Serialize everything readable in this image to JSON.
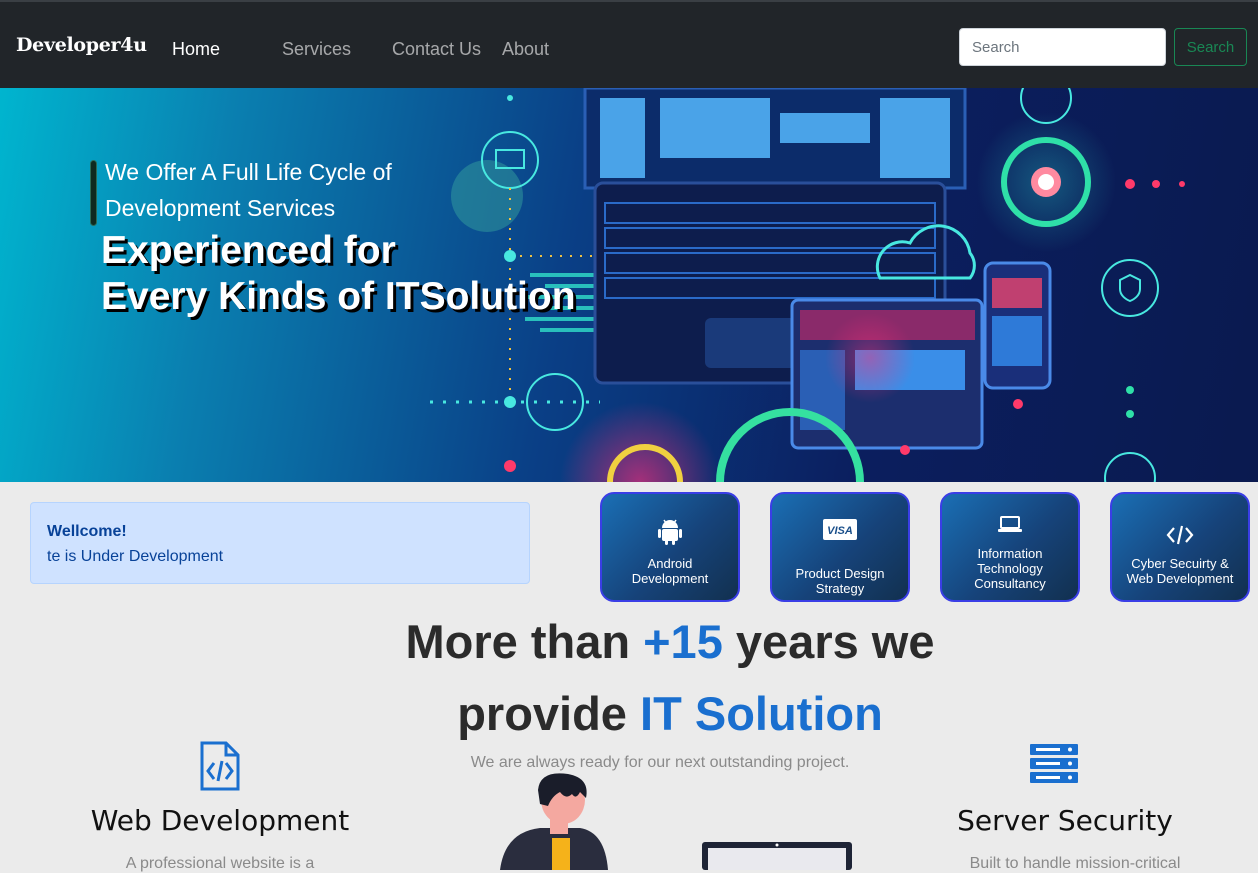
{
  "navbar": {
    "brand": "Developer4u",
    "links": [
      "Home",
      "Services",
      "Contact Us",
      "About"
    ],
    "search": {
      "placeholder": "Search",
      "button": "Search"
    }
  },
  "hero": {
    "subtitle": "We Offer A Full Life Cycle of Development Services",
    "title_line1": "Experienced for",
    "title_line2": "Every Kinds of ITSolution"
  },
  "alert": {
    "title": "Wellcome!",
    "text": "te is Under Development"
  },
  "services": [
    {
      "label": "Android Development",
      "icon": "android-icon"
    },
    {
      "label": "Product Design Strategy",
      "icon": "visa-card-icon"
    },
    {
      "label": "Information Technology Consultancy",
      "icon": "laptop-icon"
    },
    {
      "label": "Cyber Secuirty & Web Development",
      "icon": "code-icon"
    }
  ],
  "headline": {
    "part1": "More than ",
    "highlight1": "+15",
    "part2": " years we",
    "part3": "provide ",
    "highlight2": "IT Solution",
    "tagline": "We are always ready for our next outstanding project."
  },
  "features": [
    {
      "title": "Web Development",
      "text": "A professional website is a",
      "icon": "code-file-icon"
    },
    {
      "title": "Server Security",
      "text": "Built to handle mission-critical",
      "icon": "server-icon"
    }
  ],
  "colors": {
    "navbar_bg": "#212529",
    "accent": "#1a6fcf",
    "search_button": "#198754",
    "card_border": "#3a3ee6",
    "alert_bg": "#cfe2ff"
  }
}
